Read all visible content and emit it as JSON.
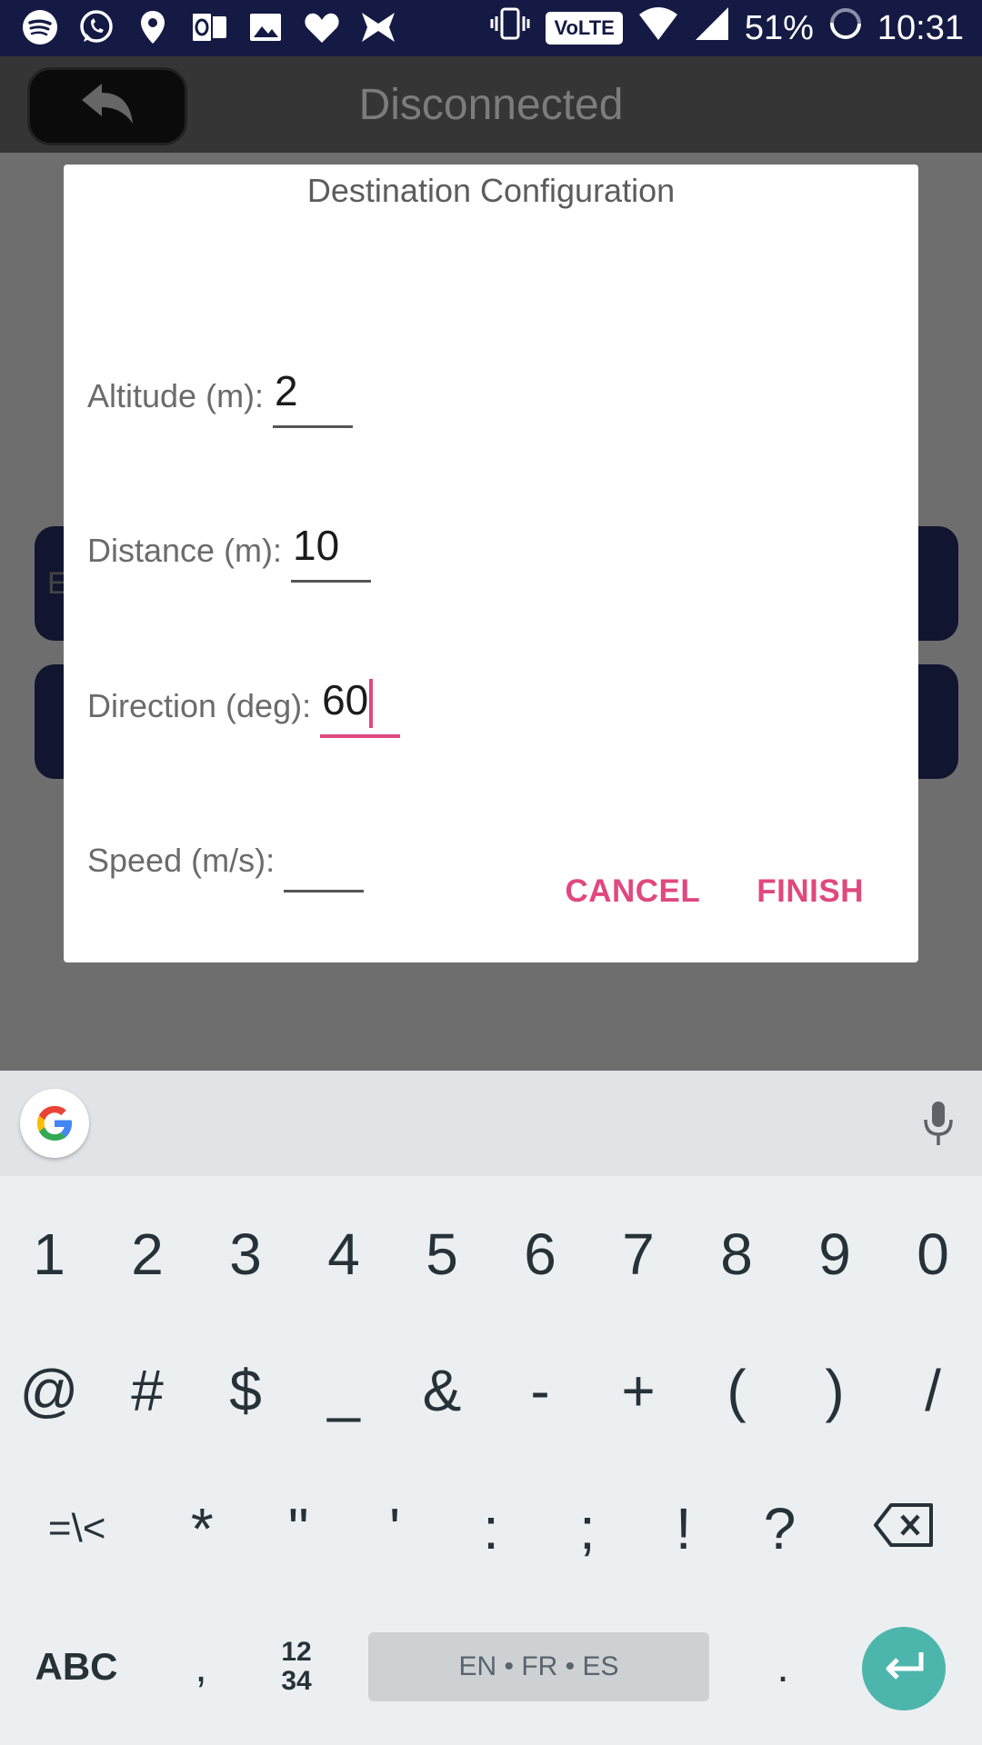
{
  "status_bar": {
    "battery": "51%",
    "time": "10:31",
    "volte_label": "VoLTE",
    "left_icons": [
      "spotify-icon",
      "whatsapp-icon",
      "location-pin-icon",
      "outlook-icon",
      "gallery-icon",
      "heart-icon",
      "bowtie-icon"
    ],
    "right_icons": [
      "vibrate-icon",
      "wifi-icon",
      "signal-icon",
      "battery-ring-icon"
    ]
  },
  "app_bar": {
    "title": "Disconnected",
    "back_icon": "undo-arrow-icon"
  },
  "background": {
    "card1_text": "E"
  },
  "dialog": {
    "title": "Destination Configuration",
    "fields": [
      {
        "label": "Altitude (m):",
        "value": "2"
      },
      {
        "label": "Distance (m):",
        "value": "10"
      },
      {
        "label": "Direction (deg):",
        "value": "60"
      },
      {
        "label": "Speed (m/s):",
        "value": ""
      }
    ],
    "cancel_label": "CANCEL",
    "finish_label": "FINISH",
    "accent_color": "#e0487f"
  },
  "keyboard": {
    "row1": [
      "1",
      "2",
      "3",
      "4",
      "5",
      "6",
      "7",
      "8",
      "9",
      "0"
    ],
    "row2": [
      "@",
      "#",
      "$",
      "_",
      "&",
      "-",
      "+",
      "(",
      ")",
      "/"
    ],
    "row3": [
      "=\\<",
      "*",
      "\"",
      "'",
      ":",
      ";",
      "!",
      "?"
    ],
    "abc_label": "ABC",
    "comma_label": ",",
    "numpad_label_top": "12",
    "numpad_label_bottom": "34",
    "space_label": "EN • FR • ES",
    "period_label": ".",
    "enter_color": "#4db6ac"
  }
}
